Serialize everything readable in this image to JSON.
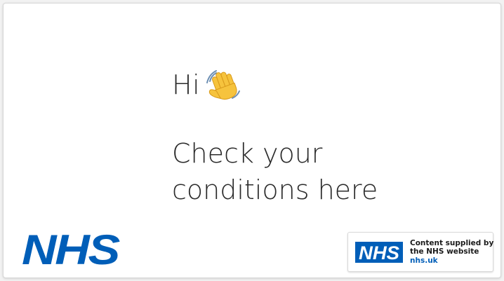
{
  "greeting": {
    "text": "Hi",
    "emoji": "waving-hand-icon"
  },
  "headline": {
    "line1": "Check your",
    "line2": "conditions here"
  },
  "logo": {
    "text": "NHS",
    "color": "#005eb8"
  },
  "attribution": {
    "logo_text": "NHS",
    "line1": "Content supplied by",
    "line2": "the NHS website",
    "link": "nhs.uk",
    "link_color": "#005eb8"
  }
}
